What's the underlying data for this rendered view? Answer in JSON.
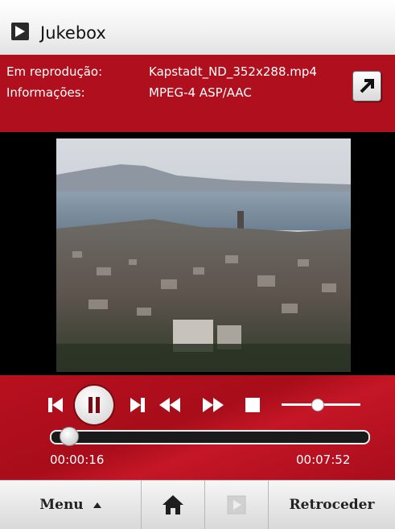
{
  "window": {
    "title": "Jukebox",
    "app_icon": "play-icon"
  },
  "now_playing": {
    "label": "Em reprodução:",
    "value": "Kapstadt_ND_352x288.mp4",
    "info_label": "Informações:",
    "info_value": "MPEG-4 ASP/AAC",
    "expand_icon": "arrow-up-right-icon"
  },
  "video": {
    "description_icon": "cityscape-video-frame"
  },
  "controls": {
    "buttons": [
      "skip-back-icon",
      "pause-icon",
      "skip-forward-icon",
      "rewind-icon",
      "fast-forward-icon",
      "stop-icon"
    ],
    "volume_level": 0.45,
    "progress": 0.035,
    "elapsed": "00:00:16",
    "total": "00:07:52"
  },
  "bottom_bar": {
    "menu_label": "Menu",
    "home_icon": "home-icon",
    "play_icon": "play-icon",
    "back_label": "Retroceder"
  },
  "colors": {
    "accent": "#b0101e",
    "control_bg": "#b8101f",
    "title_bg": "#eeeeee"
  }
}
